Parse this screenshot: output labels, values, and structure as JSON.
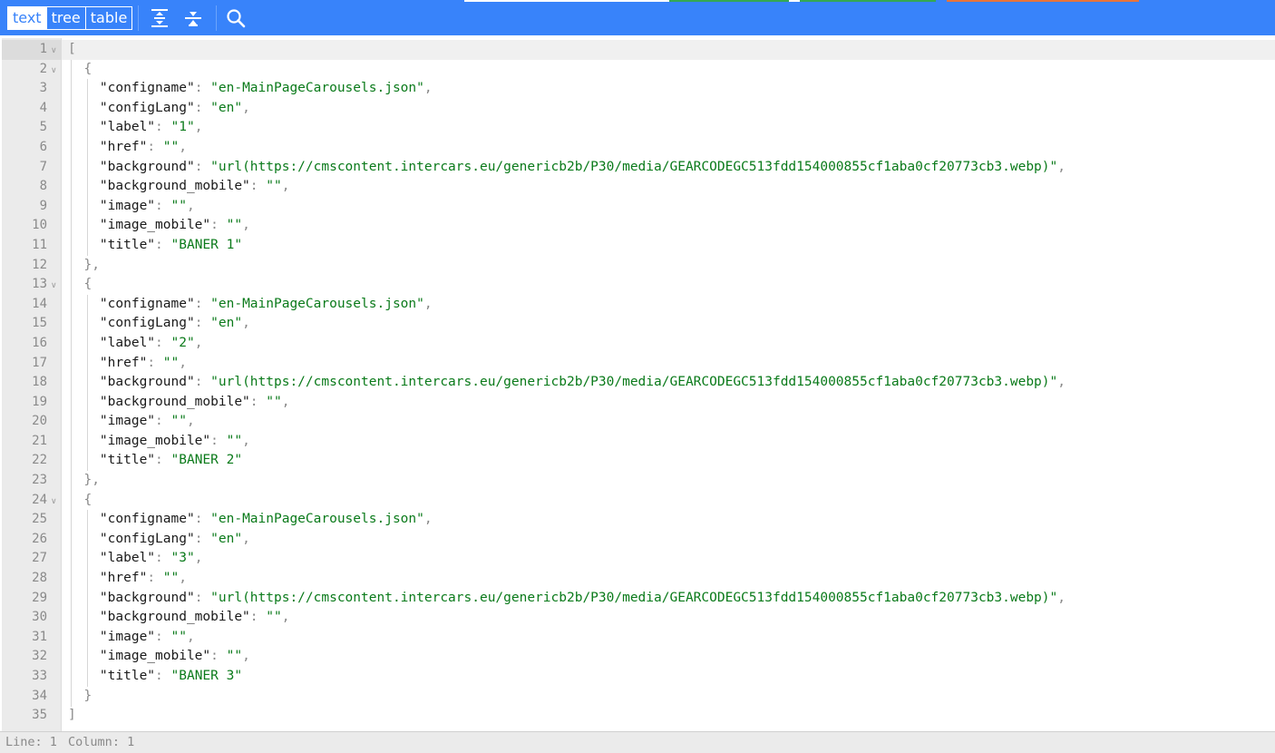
{
  "toolbar": {
    "modes": [
      {
        "label": "text",
        "active": true
      },
      {
        "label": "tree",
        "active": false
      },
      {
        "label": "table",
        "active": false
      }
    ],
    "buttons": [
      {
        "name": "expand-all-icon"
      },
      {
        "name": "collapse-all-icon"
      },
      {
        "name": "search-icon"
      }
    ],
    "accent": "#3883fa"
  },
  "editor": {
    "active_line": 1,
    "lines": [
      "[",
      "  {",
      "    \"configname\": \"en-MainPageCarousels.json\",",
      "    \"configLang\": \"en\",",
      "    \"label\": \"1\",",
      "    \"href\": \"\",",
      "    \"background\": \"url(https://cmscontent.intercars.eu/genericb2b/P30/media/GEARCODEGC513fdd154000855cf1aba0cf20773cb3.webp)\",",
      "    \"background_mobile\": \"\",",
      "    \"image\": \"\",",
      "    \"image_mobile\": \"\",",
      "    \"title\": \"BANER 1\"",
      "  },",
      "  {",
      "    \"configname\": \"en-MainPageCarousels.json\",",
      "    \"configLang\": \"en\",",
      "    \"label\": \"2\",",
      "    \"href\": \"\",",
      "    \"background\": \"url(https://cmscontent.intercars.eu/genericb2b/P30/media/GEARCODEGC513fdd154000855cf1aba0cf20773cb3.webp)\",",
      "    \"background_mobile\": \"\",",
      "    \"image\": \"\",",
      "    \"image_mobile\": \"\",",
      "    \"title\": \"BANER 2\"",
      "  },",
      "  {",
      "    \"configname\": \"en-MainPageCarousels.json\",",
      "    \"configLang\": \"en\",",
      "    \"label\": \"3\",",
      "    \"href\": \"\",",
      "    \"background\": \"url(https://cmscontent.intercars.eu/genericb2b/P30/media/GEARCODEGC513fdd154000855cf1aba0cf20773cb3.webp)\",",
      "    \"background_mobile\": \"\",",
      "    \"image\": \"\",",
      "    \"image_mobile\": \"\",",
      "    \"title\": \"BANER 3\"",
      "  }",
      "]"
    ],
    "fold_lines": [
      1,
      2,
      13,
      24
    ]
  },
  "status": {
    "line_label": "Line: 1",
    "column_label": "Column: 1"
  }
}
